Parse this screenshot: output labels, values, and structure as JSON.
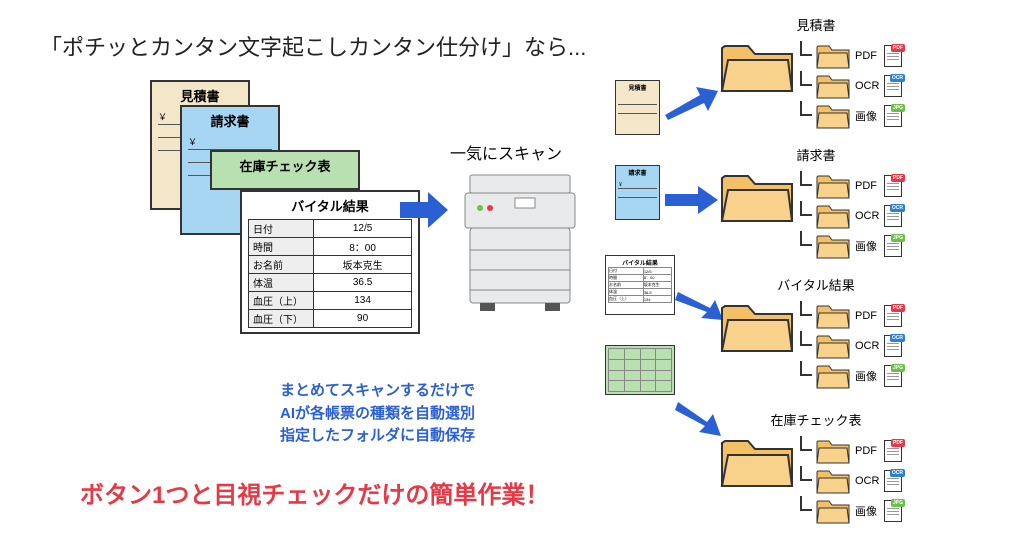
{
  "title": "「ポチッとカンタン文字起こしカンタン仕分け」なら...",
  "scan_label": "一気にスキャン",
  "docs": {
    "mitsumori": "見積書",
    "seikyu": "請求書",
    "zaiko": "在庫チェック表",
    "vital": {
      "title": "バイタル結果",
      "rows": [
        {
          "k": "日付",
          "v": "12/5"
        },
        {
          "k": "時間",
          "v": "8：00"
        },
        {
          "k": "お名前",
          "v": "坂本克生"
        },
        {
          "k": "体温",
          "v": "36.5"
        },
        {
          "k": "血圧（上）",
          "v": "134"
        },
        {
          "k": "血圧（下）",
          "v": "90"
        }
      ]
    }
  },
  "yen": "￥",
  "folders": {
    "f1": "見積書",
    "f2": "請求書",
    "f3": "バイタル結果",
    "f4": "在庫チェック表"
  },
  "file_types": {
    "pdf": "PDF",
    "ocr": "OCR",
    "img": "画像"
  },
  "badges": {
    "pdf": "PDF",
    "ocr": "OCR",
    "jpg": "JPG"
  },
  "summary": {
    "l1": "まとめてスキャンするだけで",
    "l2": "AIが各帳票の種類を自動選別",
    "l3": "指定したフォルダに自動保存"
  },
  "bottom": "ボタン1つと目視チェックだけの簡単作業！"
}
